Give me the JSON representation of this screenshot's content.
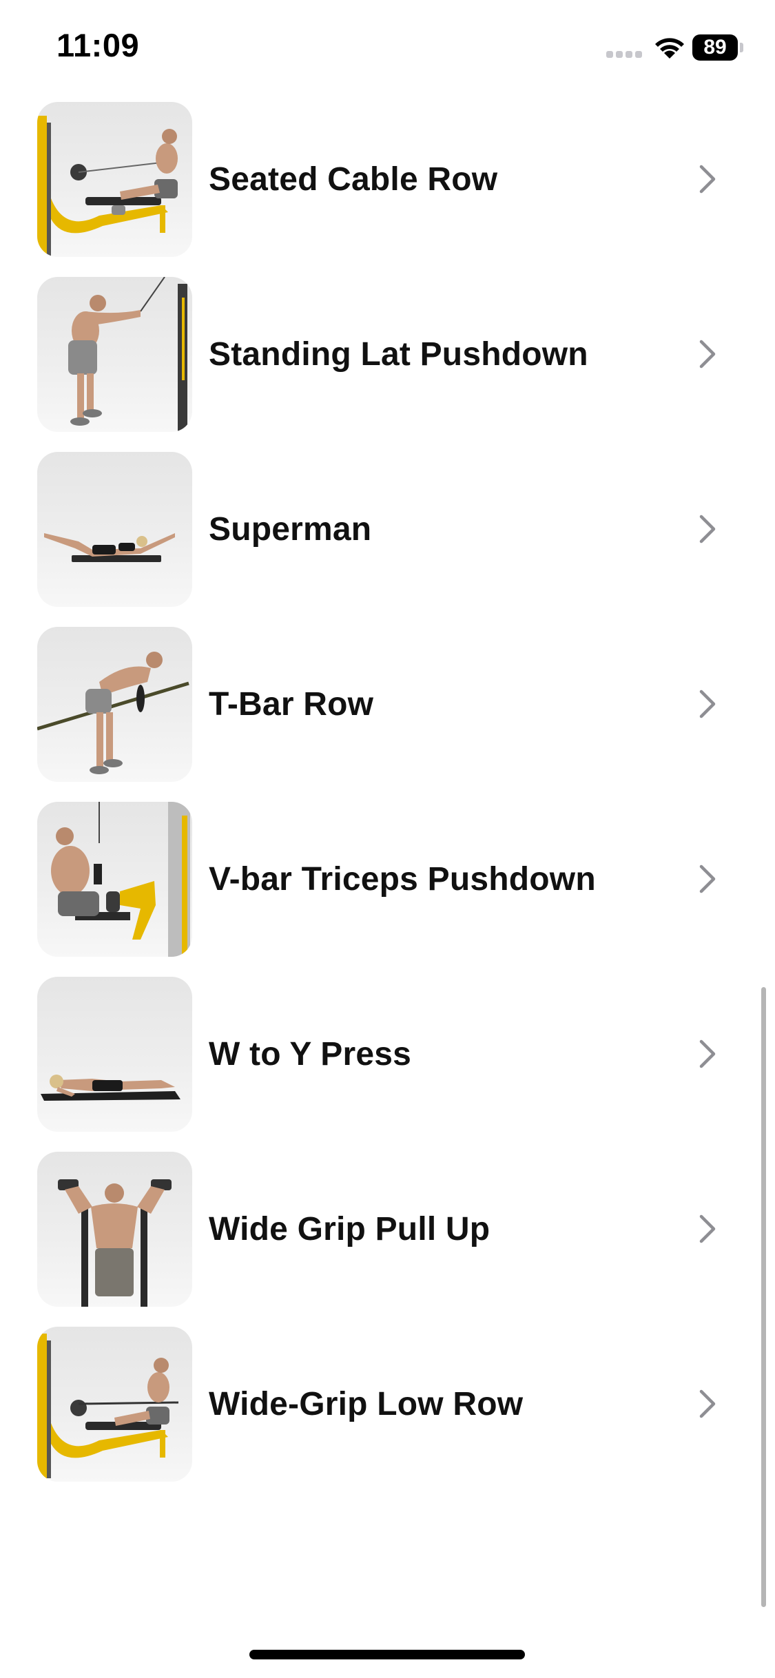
{
  "status_bar": {
    "time": "11:09",
    "battery_level": "89",
    "wifi": "wifi-icon",
    "signal": "cell-signal-icon"
  },
  "exercises": [
    {
      "name": "Seated Cable Row",
      "thumbnail": "seated-cable-row-thumbnail"
    },
    {
      "name": "Standing Lat Pushdown",
      "thumbnail": "standing-lat-pushdown-thumbnail"
    },
    {
      "name": "Superman",
      "thumbnail": "superman-thumbnail"
    },
    {
      "name": "T-Bar Row",
      "thumbnail": "t-bar-row-thumbnail"
    },
    {
      "name": "V-bar Triceps Pushdown",
      "thumbnail": "v-bar-triceps-pushdown-thumbnail"
    },
    {
      "name": "W to Y Press",
      "thumbnail": "w-to-y-press-thumbnail"
    },
    {
      "name": "Wide Grip Pull Up",
      "thumbnail": "wide-grip-pull-up-thumbnail"
    },
    {
      "name": "Wide-Grip Low Row",
      "thumbnail": "wide-grip-low-row-thumbnail"
    }
  ],
  "colors": {
    "machine_yellow": "#e6b800",
    "chevron": "#8e8e93",
    "scroll_indicator": "#b5b5b5"
  }
}
